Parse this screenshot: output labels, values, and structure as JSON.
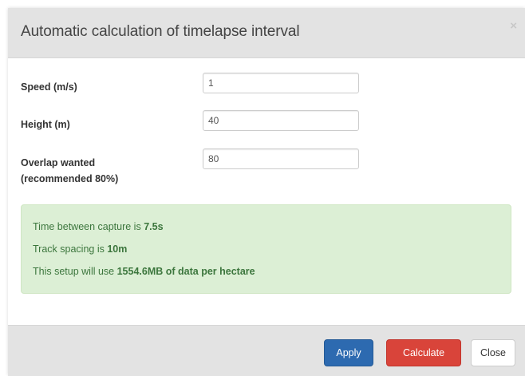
{
  "dialog": {
    "title": "Automatic calculation of timelapse interval",
    "close_icon": "×"
  },
  "form": {
    "fields": [
      {
        "label": "Speed (m/s)",
        "value": "1"
      },
      {
        "label": "Height (m)",
        "value": "40"
      },
      {
        "label": "Overlap wanted\n(recommended 80%)",
        "value": "80"
      }
    ]
  },
  "result": {
    "line1_prefix": "Time between capture is ",
    "line1_value": "7.5s",
    "line2_prefix": "Track spacing is ",
    "line2_value": "10m",
    "line3_prefix": "This setup will use ",
    "line3_value": "1554.6MB of data per hectare"
  },
  "footer": {
    "apply_label": "Apply",
    "calculate_label": "Calculate",
    "close_label": "Close"
  },
  "colors": {
    "header_bg": "#e3e3e3",
    "success_bg": "#dcefd5",
    "success_text": "#3c763d",
    "primary": "#2d6ab0",
    "danger": "#d9443a"
  }
}
